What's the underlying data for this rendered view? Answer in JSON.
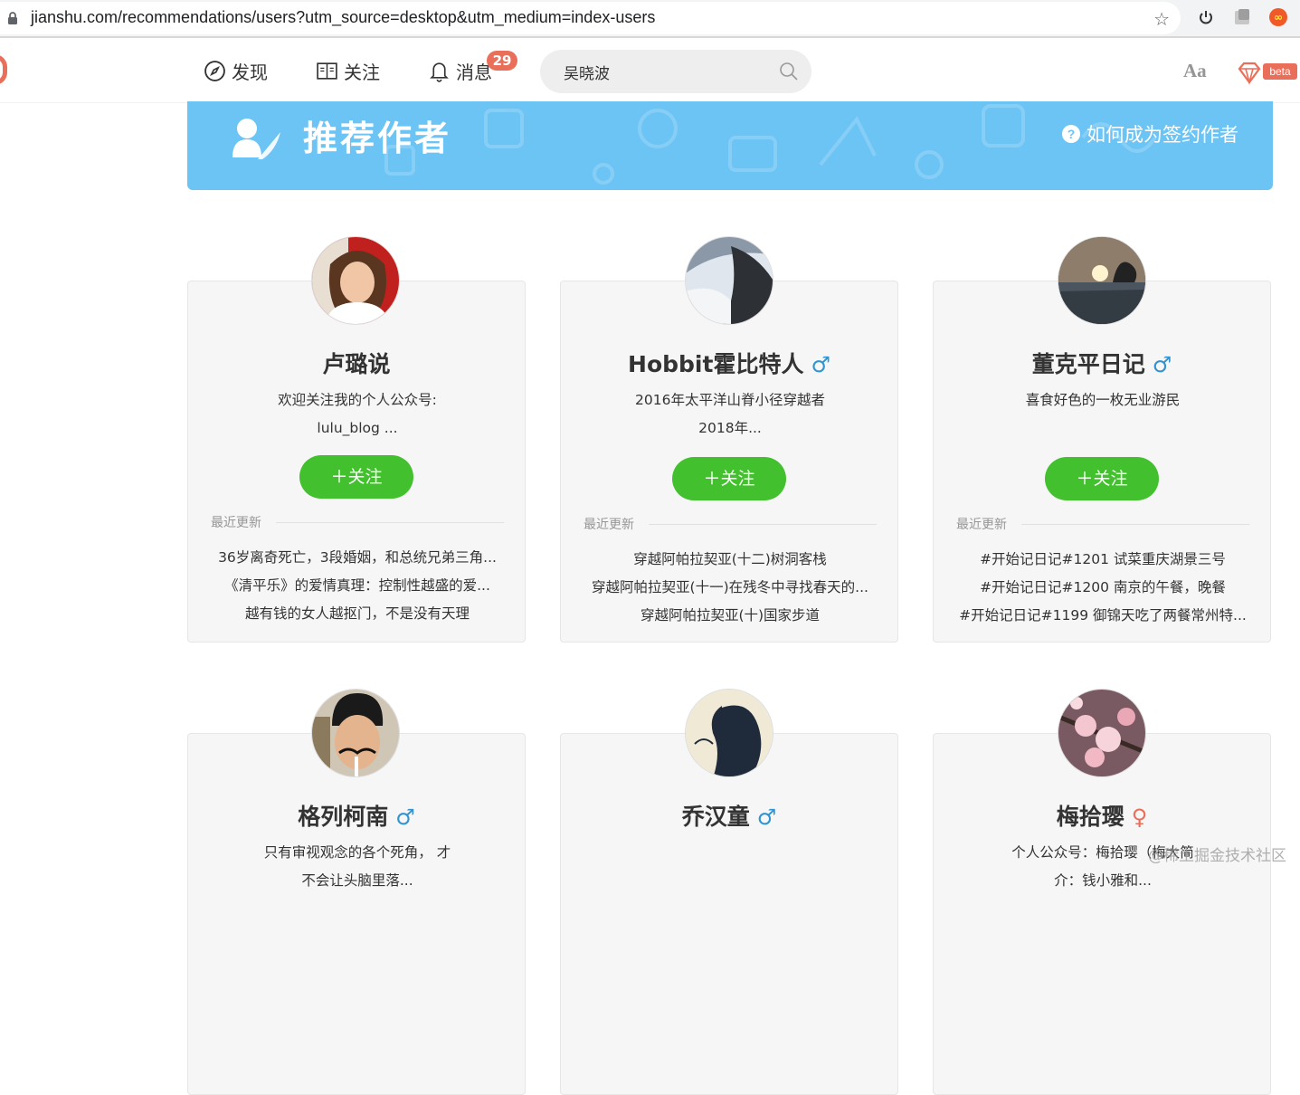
{
  "browser": {
    "url": "jianshu.com/recommendations/users?utm_source=desktop&utm_medium=index-users"
  },
  "header": {
    "nav": [
      {
        "label": "发现",
        "icon": "compass-icon"
      },
      {
        "label": "关注",
        "icon": "book-icon"
      },
      {
        "label": "消息",
        "icon": "bell-icon"
      }
    ],
    "message_count": "29",
    "search_value": "吴晓波",
    "font_button": "Aa",
    "beta_label": "beta"
  },
  "banner": {
    "title": "推荐作者",
    "help_text": "如何成为签约作者"
  },
  "colors": {
    "accent": "#ea6f5a",
    "follow_green": "#42c02e",
    "banner_blue": "#6cc4f5",
    "male_blue": "#3194d0"
  },
  "authors": [
    {
      "name": "卢璐说",
      "gender": "",
      "desc": [
        "欢迎关注我的个人公众号:",
        "lulu_blog ..."
      ],
      "follow_label": "关注",
      "recent_label": "最近更新",
      "recent": [
        "36岁离奇死亡，3段婚姻，和总统兄弟三角...",
        "《清平乐》的爱情真理：控制性越盛的爱...",
        "越有钱的女人越抠门，不是没有天理"
      ]
    },
    {
      "name": "Hobbit霍比特人",
      "gender": "♂",
      "desc": [
        "2016年太平洋山脊小径穿越者",
        "2018年..."
      ],
      "follow_label": "关注",
      "recent_label": "最近更新",
      "recent": [
        "穿越阿帕拉契亚(十二)树洞客栈",
        "穿越阿帕拉契亚(十一)在残冬中寻找春天的...",
        "穿越阿帕拉契亚(十)国家步道"
      ]
    },
    {
      "name": "董克平日记",
      "gender": "♂",
      "desc": [
        "喜食好色的一枚无业游民"
      ],
      "follow_label": "关注",
      "recent_label": "最近更新",
      "recent": [
        "#开始记日记#1201 试菜重庆湖景三号",
        "#开始记日记#1200 南京的午餐，晚餐",
        "#开始记日记#1199 御锦天吃了两餐常州特..."
      ]
    },
    {
      "name": "格列柯南",
      "gender": "♂",
      "desc": [
        "只有审视观念的各个死角， 才",
        "不会让头脑里落..."
      ]
    },
    {
      "name": "乔汉童",
      "gender": "♂",
      "desc": []
    },
    {
      "name": "梅拾璎",
      "gender": "♀",
      "desc": [
        "个人公众号：梅拾璎（梅大简",
        "介：钱小雅和..."
      ]
    }
  ],
  "watermark": "@稀土掘金技术社区"
}
